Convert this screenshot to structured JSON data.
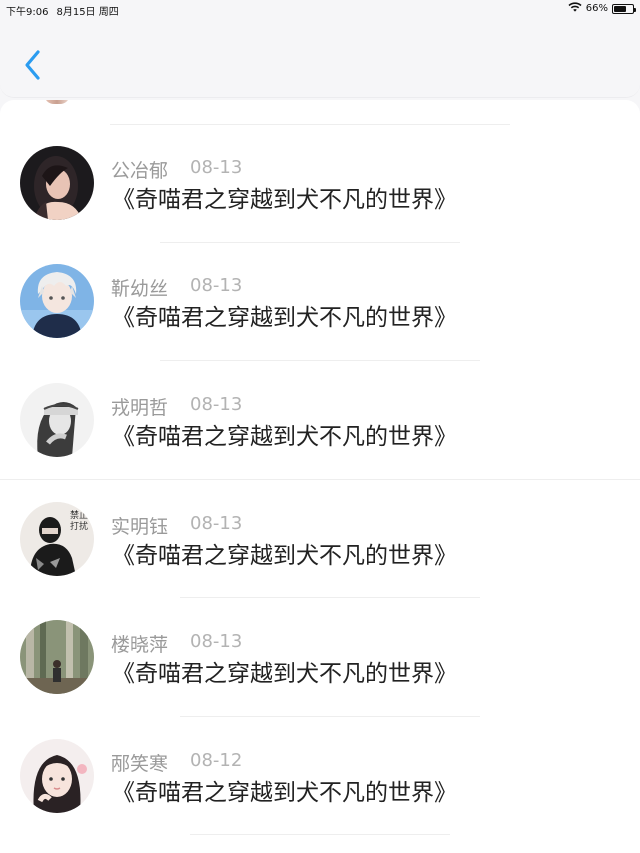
{
  "status_bar": {
    "time": "下午9:06",
    "date": "8月15日 周四",
    "battery": "66%",
    "battery_level": 0.66
  },
  "nav": {
    "back_icon": "chevron-left-icon",
    "accent_color": "#2b9cf0"
  },
  "comments": [
    {
      "name": "公冶郁",
      "date": "08-13",
      "title": "《奇喵君之穿越到犬不凡的世界》"
    },
    {
      "name": "靳幼丝",
      "date": "08-13",
      "title": "《奇喵君之穿越到犬不凡的世界》"
    },
    {
      "name": "戎明哲",
      "date": "08-13",
      "title": "《奇喵君之穿越到犬不凡的世界》"
    },
    {
      "name": "实明钰",
      "date": "08-13",
      "title": "《奇喵君之穿越到犬不凡的世界》"
    },
    {
      "name": "楼晓萍",
      "date": "08-13",
      "title": "《奇喵君之穿越到犬不凡的世界》"
    },
    {
      "name": "邴笑寒",
      "date": "08-12",
      "title": "《奇喵君之穿越到犬不凡的世界》"
    }
  ]
}
